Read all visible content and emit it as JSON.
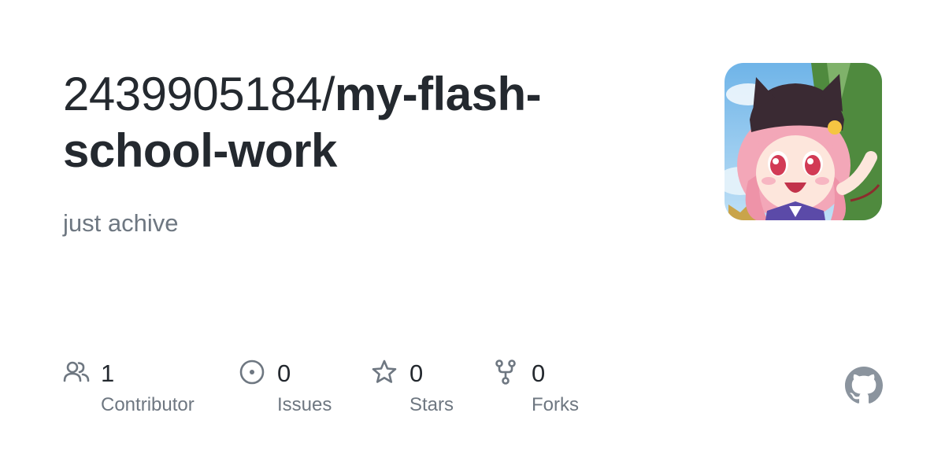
{
  "repo": {
    "owner": "2439905184/",
    "name_line1": "my-flash-",
    "name_line2": "school-work",
    "description": "just achive"
  },
  "avatar": {
    "icon": "anime-avatar-image"
  },
  "stats": [
    {
      "icon": "people-icon",
      "count": "1",
      "label": "Contributor"
    },
    {
      "icon": "issue-opened-icon",
      "count": "0",
      "label": "Issues"
    },
    {
      "icon": "star-icon",
      "count": "0",
      "label": "Stars"
    },
    {
      "icon": "repo-forked-icon",
      "count": "0",
      "label": "Forks"
    }
  ],
  "branding": {
    "logo": "github-mark-icon"
  },
  "colors": {
    "text_primary": "#24292f",
    "text_secondary": "#6e7781",
    "logo": "#8b949e"
  }
}
